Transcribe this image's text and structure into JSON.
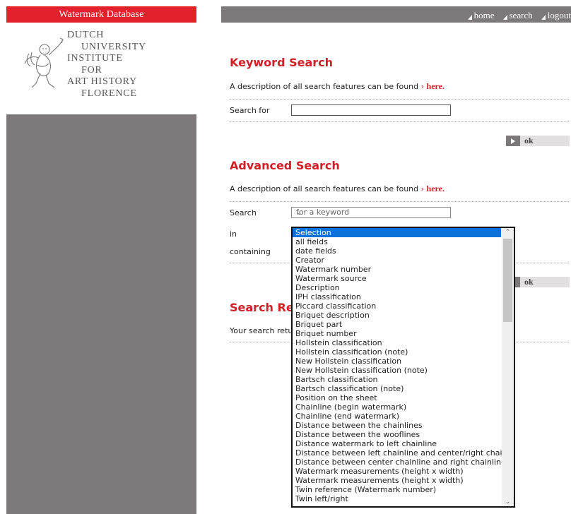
{
  "sidebar": {
    "brand": "Watermark Database",
    "institute_lines": [
      "DUTCH",
      "UNIVERSITY",
      "INSTITUTE",
      "FOR",
      "ART HISTORY",
      "FLORENCE"
    ]
  },
  "topnav": {
    "home": "home",
    "search": "search",
    "logout": "logout"
  },
  "keyword": {
    "title": "Keyword Search",
    "desc_prefix": "A description of all search features can be found",
    "desc_arrow": "›",
    "desc_link": "here.",
    "search_for_label": "Search for",
    "search_value": "",
    "ok_label": "ok"
  },
  "advanced": {
    "title": "Advanced Search",
    "desc_prefix": "A description of all search features can be found",
    "desc_arrow": "›",
    "desc_link": "here.",
    "search_label": "Search",
    "search_select_value": "for a keyword",
    "in_label": "in",
    "containing_label": "containing",
    "ok_label": "ok"
  },
  "results": {
    "title": "Search Res",
    "text": "Your search retur"
  },
  "dropdown": {
    "selected_index": 0,
    "options": [
      "Selection",
      "all fields",
      "date fields",
      "Creator",
      "Watermark number",
      "Watermark source",
      "Description",
      "IPH classification",
      "Piccard classification",
      "Briquet description",
      "Briquet part",
      "Briquet number",
      "Hollstein classification",
      "Hollstein classification (note)",
      "New Hollstein classification",
      "New Hollstein classification (note)",
      "Bartsch classification",
      "Bartsch classification (note)",
      "Position on the sheet",
      "Chainline (begin watermark)",
      "Chainline (end watermark)",
      "Distance between the chainlines",
      "Distance between the wooflines",
      "Distance watermark to left chainline",
      "Distance between left chainline and center/right chainline",
      "Distance between center chainline and right chainline",
      "Watermark measurements (height x width)",
      "Watermark measurements (height x width)",
      "Twin reference (Watermark number)",
      "Twin left/right"
    ]
  },
  "colors": {
    "brand_red": "#e3212d",
    "heading_red": "#d02027",
    "sidebar_gray": "#7d7879",
    "selection_blue": "#0a72d9"
  }
}
